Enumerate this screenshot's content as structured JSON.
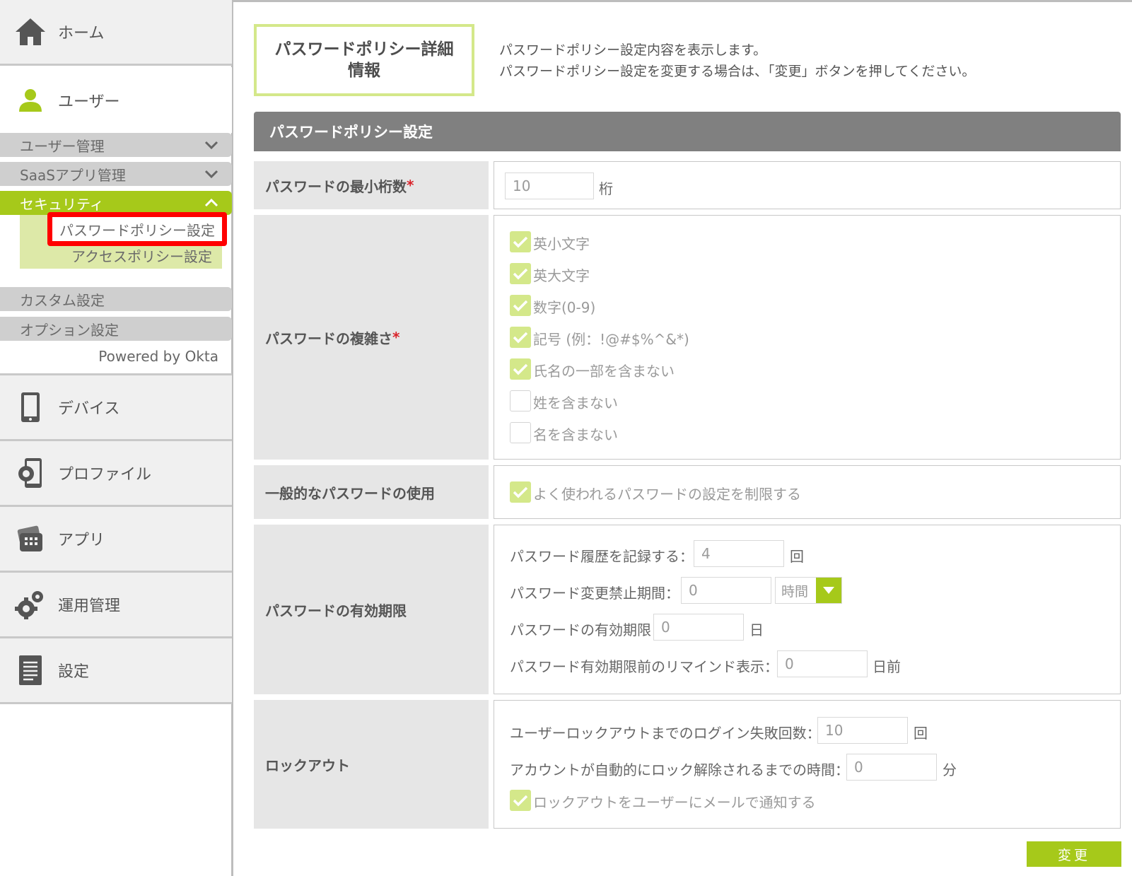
{
  "sidebar": {
    "home": "ホーム",
    "user": "ユーザー",
    "accordions": {
      "user_mgmt": "ユーザー管理",
      "saas_mgmt": "SaaSアプリ管理",
      "security": "セキュリティ",
      "custom": "カスタム設定",
      "option": "オプション設定"
    },
    "security_items": [
      "パスワードポリシー設定",
      "アクセスポリシー設定"
    ],
    "powered_by": "Powered by Okta",
    "nav": [
      "デバイス",
      "プロファイル",
      "アプリ",
      "運用管理",
      "設定"
    ]
  },
  "page": {
    "title_line1": "パスワードポリシー詳細",
    "title_line2": "情報",
    "description_line1": "パスワードポリシー設定内容を表示します。",
    "description_line2": "パスワードポリシー設定を変更する場合は、「変更」ボタンを押してください。",
    "section_title": "パスワードポリシー設定"
  },
  "min_length": {
    "label": "パスワードの最小桁数",
    "required_mark": "*",
    "value": "10",
    "unit": "桁"
  },
  "complexity": {
    "label": "パスワードの複雑さ",
    "required_mark": "*",
    "options": [
      {
        "label": "英小文字",
        "checked": true
      },
      {
        "label": "英大文字",
        "checked": true
      },
      {
        "label": "数字(0-9)",
        "checked": true
      },
      {
        "label": "記号 (例：!@#$%^&*)",
        "checked": true
      },
      {
        "label": "氏名の一部を含まない",
        "checked": true
      },
      {
        "label": "姓を含まない",
        "checked": false
      },
      {
        "label": "名を含まない",
        "checked": false
      }
    ]
  },
  "common_password": {
    "label": "一般的なパスワードの使用",
    "option": "よく使われるパスワードの設定を制限する",
    "checked": true
  },
  "expiry": {
    "label": "パスワードの有効期限",
    "history_label": "パスワード履歴を記録する：",
    "history_value": "4",
    "history_unit": "回",
    "min_age_label": "パスワード変更禁止期間：",
    "min_age_value": "0",
    "min_age_unit": "時間",
    "max_age_label": "パスワードの有効期限",
    "max_age_value": "0",
    "max_age_unit": "日",
    "remind_label": "パスワード有効期限前のリマインド表示：",
    "remind_value": "0",
    "remind_unit": "日前"
  },
  "lockout": {
    "label": "ロックアウト",
    "attempts_label": "ユーザーロックアウトまでのログイン失敗回数：",
    "attempts_value": "10",
    "attempts_unit": "回",
    "unlock_label": "アカウントが自動的にロック解除されるまでの時間：",
    "unlock_value": "0",
    "unlock_unit": "分",
    "notify_label": "ロックアウトをユーザーにメールで通知する",
    "notify_checked": true
  },
  "change_button": "変更",
  "colors": {
    "accent": "#a6c91a",
    "accent_light": "#d4e88a",
    "header_gray": "#808080",
    "highlight_red": "#ff0000"
  },
  "icons": [
    "home-icon",
    "user-icon",
    "chevron-down-icon",
    "chevron-up-icon",
    "device-icon",
    "profile-icon",
    "app-icon",
    "gear-icon",
    "document-icon",
    "check-icon",
    "dropdown-arrow-icon"
  ]
}
